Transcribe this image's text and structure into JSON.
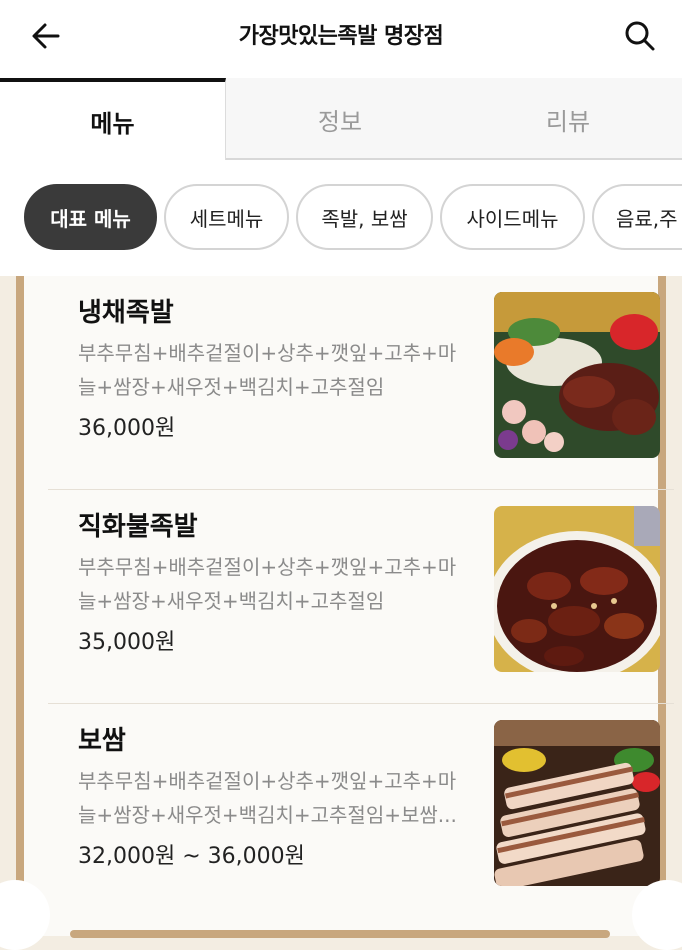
{
  "header": {
    "title": "가장맛있는족발 명장점",
    "back_icon": "arrow-left-icon",
    "search_icon": "search-icon"
  },
  "tabs": [
    {
      "label": "메뉴",
      "active": true
    },
    {
      "label": "정보",
      "active": false
    },
    {
      "label": "리뷰",
      "active": false
    }
  ],
  "categories": [
    {
      "label": "대표 메뉴",
      "active": true
    },
    {
      "label": "세트메뉴",
      "active": false
    },
    {
      "label": "족발, 보쌈",
      "active": false
    },
    {
      "label": "사이드메뉴",
      "active": false
    },
    {
      "label": "음료,주",
      "active": false
    }
  ],
  "menu_items": [
    {
      "name": "냉채족발",
      "description": "부추무침+배추겉절이+상추+깻잎+고추+마늘+쌈장+새우젓+백김치+고추절임",
      "price": "36,000원"
    },
    {
      "name": "직화불족발",
      "description": "부추무침+배추겉절이+상추+깻잎+고추+마늘+쌈장+새우젓+백김치+고추절임",
      "price": "35,000원"
    },
    {
      "name": "보쌈",
      "description": "부추무침+배추겉절이+상추+깻잎+고추+마늘+쌈장+새우젓+백김치+고추절임+보쌈...",
      "price": "32,000원 ~ 36,000원"
    }
  ],
  "colors": {
    "accent_border": "#c8a77e",
    "chip_active": "#3a3a3a"
  }
}
